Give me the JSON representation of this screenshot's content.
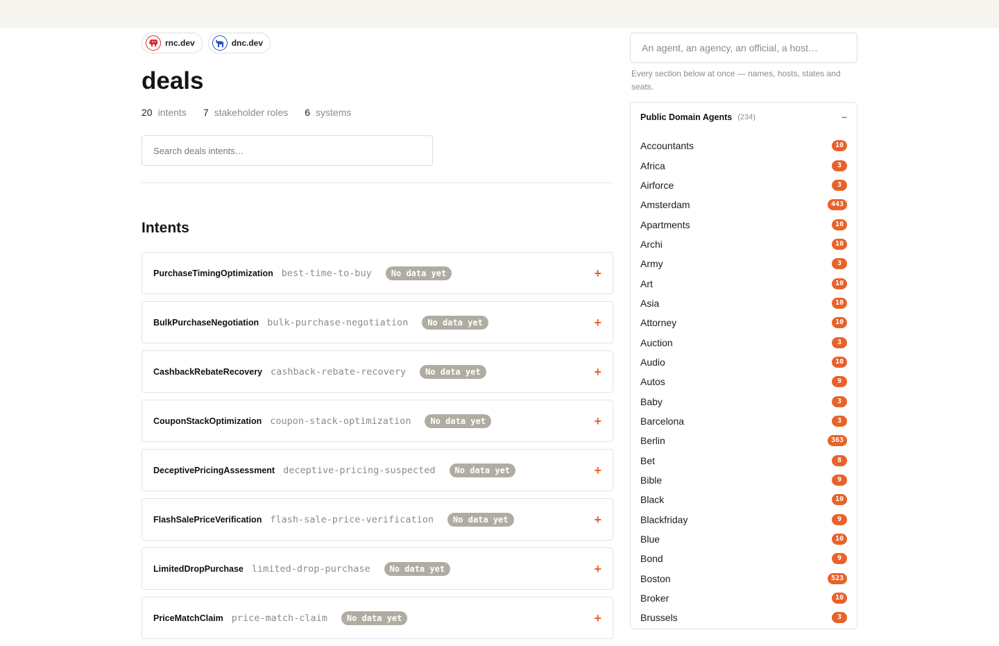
{
  "header": {
    "chips": [
      {
        "label": "rnc.dev",
        "icon": "elephant-icon",
        "color": "#d72b2b"
      },
      {
        "label": "dnc.dev",
        "icon": "donkey-icon",
        "color": "#2554c7"
      }
    ],
    "title": "deals",
    "stats": [
      {
        "value": "20",
        "label": "intents"
      },
      {
        "value": "7",
        "label": "stakeholder roles"
      },
      {
        "value": "6",
        "label": "systems"
      }
    ],
    "search_placeholder": "Search deals intents…"
  },
  "intents_section": {
    "title": "Intents",
    "expand_glyph": "+",
    "items": [
      {
        "name": "PurchaseTimingOptimization",
        "slug": "best-time-to-buy",
        "badge": "No data yet"
      },
      {
        "name": "BulkPurchaseNegotiation",
        "slug": "bulk-purchase-negotiation",
        "badge": "No data yet"
      },
      {
        "name": "CashbackRebateRecovery",
        "slug": "cashback-rebate-recovery",
        "badge": "No data yet"
      },
      {
        "name": "CouponStackOptimization",
        "slug": "coupon-stack-optimization",
        "badge": "No data yet"
      },
      {
        "name": "DeceptivePricingAssessment",
        "slug": "deceptive-pricing-suspected",
        "badge": "No data yet"
      },
      {
        "name": "FlashSalePriceVerification",
        "slug": "flash-sale-price-verification",
        "badge": "No data yet"
      },
      {
        "name": "LimitedDropPurchase",
        "slug": "limited-drop-purchase",
        "badge": "No data yet"
      },
      {
        "name": "PriceMatchClaim",
        "slug": "price-match-claim",
        "badge": "No data yet"
      }
    ]
  },
  "sidebar": {
    "search_placeholder": "An agent, an agency, an official, a host…",
    "note": "Every section below at once — names, hosts, states and seats.",
    "panel": {
      "title": "Public Domain Agents",
      "count": "(234)",
      "collapse_glyph": "−",
      "items": [
        {
          "name": "Accountants",
          "count": "10"
        },
        {
          "name": "Africa",
          "count": "3"
        },
        {
          "name": "Airforce",
          "count": "3"
        },
        {
          "name": "Amsterdam",
          "count": "443"
        },
        {
          "name": "Apartments",
          "count": "10"
        },
        {
          "name": "Archi",
          "count": "10"
        },
        {
          "name": "Army",
          "count": "3"
        },
        {
          "name": "Art",
          "count": "10"
        },
        {
          "name": "Asia",
          "count": "10"
        },
        {
          "name": "Attorney",
          "count": "10"
        },
        {
          "name": "Auction",
          "count": "3"
        },
        {
          "name": "Audio",
          "count": "10"
        },
        {
          "name": "Autos",
          "count": "9"
        },
        {
          "name": "Baby",
          "count": "3"
        },
        {
          "name": "Barcelona",
          "count": "3"
        },
        {
          "name": "Berlin",
          "count": "363"
        },
        {
          "name": "Bet",
          "count": "8"
        },
        {
          "name": "Bible",
          "count": "9"
        },
        {
          "name": "Black",
          "count": "10"
        },
        {
          "name": "Blackfriday",
          "count": "9"
        },
        {
          "name": "Blue",
          "count": "10"
        },
        {
          "name": "Bond",
          "count": "9"
        },
        {
          "name": "Boston",
          "count": "523"
        },
        {
          "name": "Broker",
          "count": "10"
        },
        {
          "name": "Brussels",
          "count": "3"
        }
      ]
    }
  },
  "colors": {
    "accent": "#e8622a",
    "badge_gray": "#b0aca1",
    "topbar": "#f5f4ee"
  }
}
